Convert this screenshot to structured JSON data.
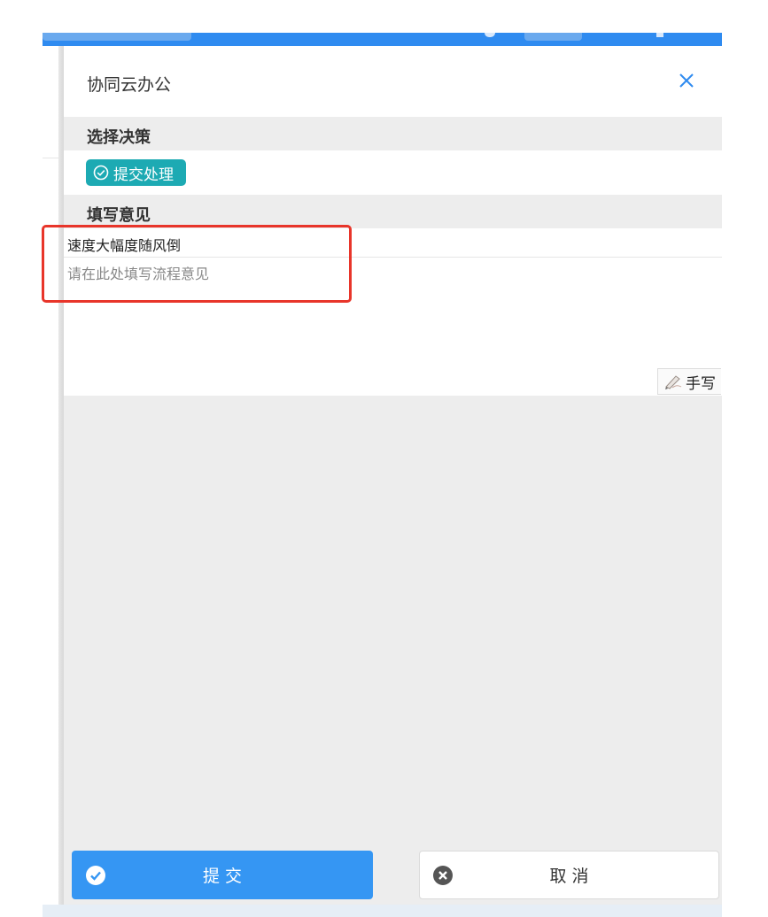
{
  "dialog": {
    "title": "协同云办公",
    "close_icon": "close-icon"
  },
  "decision": {
    "section_label": "选择决策",
    "selected_option": "提交处理",
    "option_icon": "check-circle-icon",
    "accent_color": "#1daab3"
  },
  "opinion": {
    "section_label": "填写意见",
    "input_value": "速度大幅度随风倒",
    "textarea_placeholder": "请在此处填写流程意见",
    "handwrite_label": "手写",
    "handwrite_icon": "pen-icon"
  },
  "actions": {
    "submit_label": "提 交",
    "submit_icon": "check-circle-icon",
    "submit_color": "#3596f3",
    "cancel_label": "取 消",
    "cancel_icon": "close-circle-icon"
  },
  "annotation": {
    "highlight_color": "#e8352a"
  }
}
